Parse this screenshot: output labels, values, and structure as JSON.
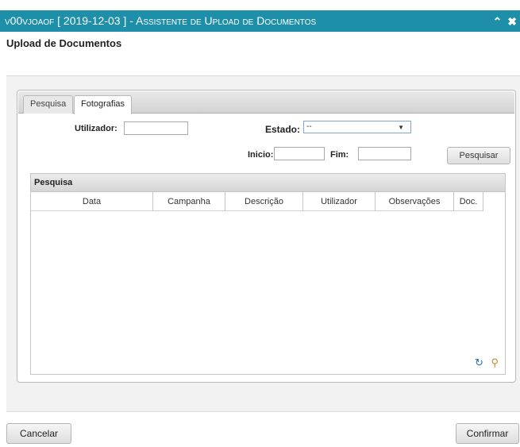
{
  "window": {
    "title": "v00vjoaof [ 2019-12-03 ] - Assistente de Upload de Documentos",
    "collapse_icon": "chevron-up-icon",
    "close_icon": "close-icon"
  },
  "page": {
    "heading": "Upload de Documentos"
  },
  "tabs": [
    {
      "label": "Pesquisa",
      "active": false
    },
    {
      "label": "Fotografias",
      "active": true
    }
  ],
  "filters": {
    "utilizador_label": "Utilizador:",
    "utilizador_value": "",
    "estado_label": "Estado:",
    "estado_value": "--",
    "inicio_label": "Inicio:",
    "inicio_value": "",
    "fim_label": "Fim:",
    "fim_value": "",
    "search_button": "Pesquisar"
  },
  "grid": {
    "caption": "Pesquisa",
    "columns": [
      "Data",
      "Campanha",
      "Descrição",
      "Utilizador",
      "Observações",
      "Doc."
    ],
    "rows": [],
    "footer_icons": [
      "refresh-icon",
      "search-icon"
    ]
  },
  "actions": {
    "cancel": "Cancelar",
    "confirm": "Confirmar"
  },
  "colors": {
    "titlebar": "#1d8fa8",
    "panel": "#f2f2f2",
    "accent_border": "#7aa7d6"
  }
}
